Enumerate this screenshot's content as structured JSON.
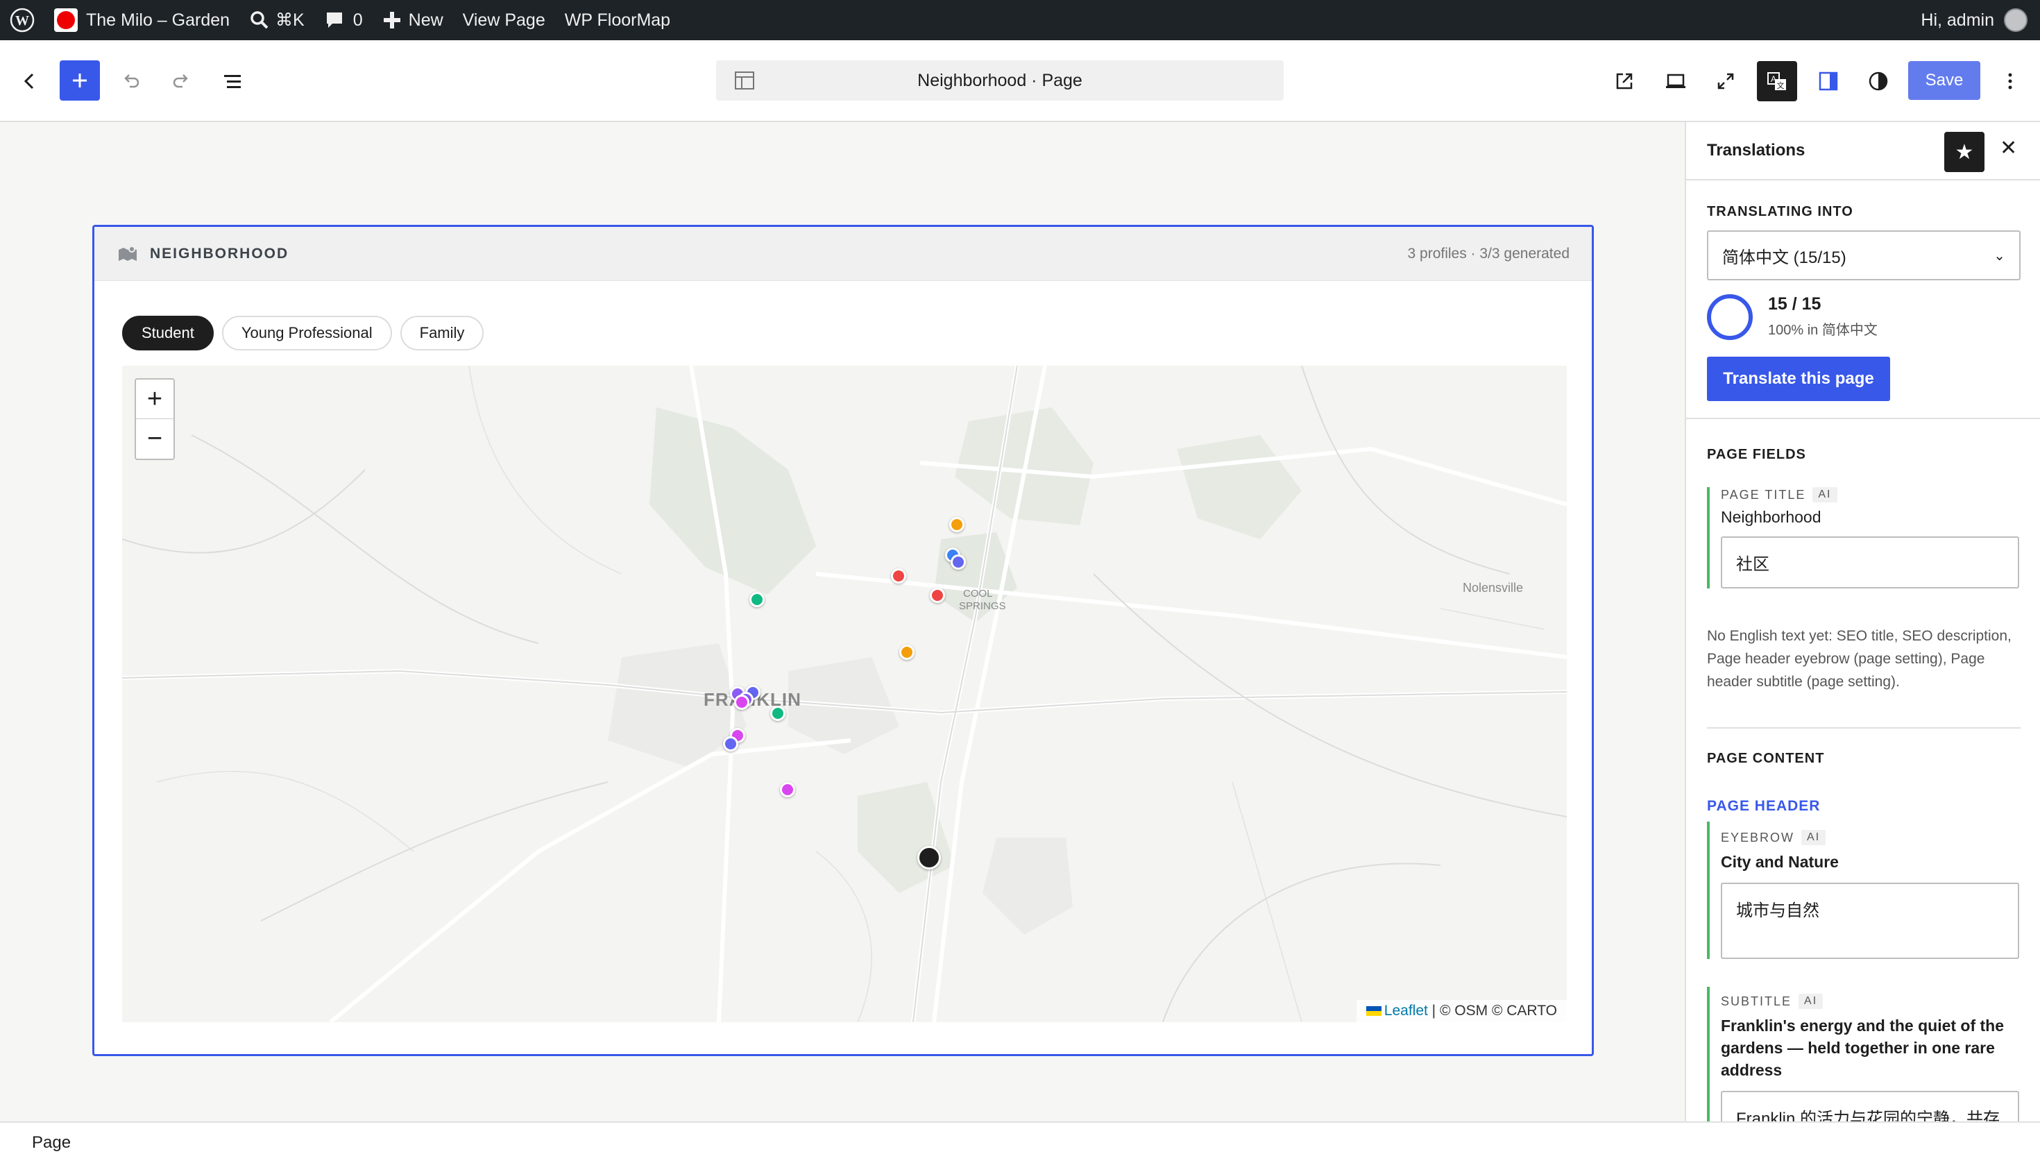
{
  "admin_bar": {
    "site_name": "The Milo – Garden",
    "search_shortcut": "⌘K",
    "comments_count": "0",
    "new_label": "New",
    "view_page_label": "View Page",
    "plugin_label": "WP FloorMap",
    "greeting": "Hi, admin"
  },
  "editor": {
    "document_title": "Neighborhood · Page",
    "save_label": "Save",
    "accent_color": "#3858e9"
  },
  "block": {
    "title": "NEIGHBORHOOD",
    "meta": "3 profiles · 3/3 generated",
    "tabs": [
      {
        "label": "Student",
        "active": true
      },
      {
        "label": "Young Professional",
        "active": false
      },
      {
        "label": "Family",
        "active": false
      }
    ],
    "map": {
      "zoom_in": "+",
      "zoom_out": "−",
      "town_label": "FRANKLIN",
      "place_label": "Nolensville",
      "springs_label_1": "COOL",
      "springs_label_2": "SPRINGS",
      "attribution_link": "Leaflet",
      "attribution_text": " | © OSM © CARTO",
      "pin_colors": [
        "#f59e0b",
        "#ef4444",
        "#10b981",
        "#8b5cf6",
        "#d946ef",
        "#6366f1",
        "#3b82f6"
      ]
    }
  },
  "sidebar": {
    "title": "Translations",
    "translating_into_label": "TRANSLATING INTO",
    "language_value": "简体中文 (15/15)",
    "progress_count": "15 / 15",
    "progress_percent": "100% in 简体中文",
    "progress_fraction": 1.0,
    "translate_button": "Translate this page",
    "page_fields_label": "PAGE FIELDS",
    "page_title_field": {
      "label": "PAGE TITLE",
      "badge": "AI",
      "source": "Neighborhood",
      "translation": "社区"
    },
    "note": "No English text yet: SEO title, SEO description, Page header eyebrow (page setting), Page header subtitle (page setting).",
    "page_content_label": "PAGE CONTENT",
    "page_header_label": "PAGE HEADER",
    "eyebrow_field": {
      "label": "EYEBROW",
      "badge": "AI",
      "source": "City and Nature",
      "translation": "城市与自然"
    },
    "subtitle_field": {
      "label": "SUBTITLE",
      "badge": "AI",
      "source": "Franklin's energy and the quiet of the gardens — held together in one rare address",
      "translation": "Franklin 的活力与花园的宁静，共存"
    }
  },
  "footer": {
    "breadcrumb": "Page"
  }
}
